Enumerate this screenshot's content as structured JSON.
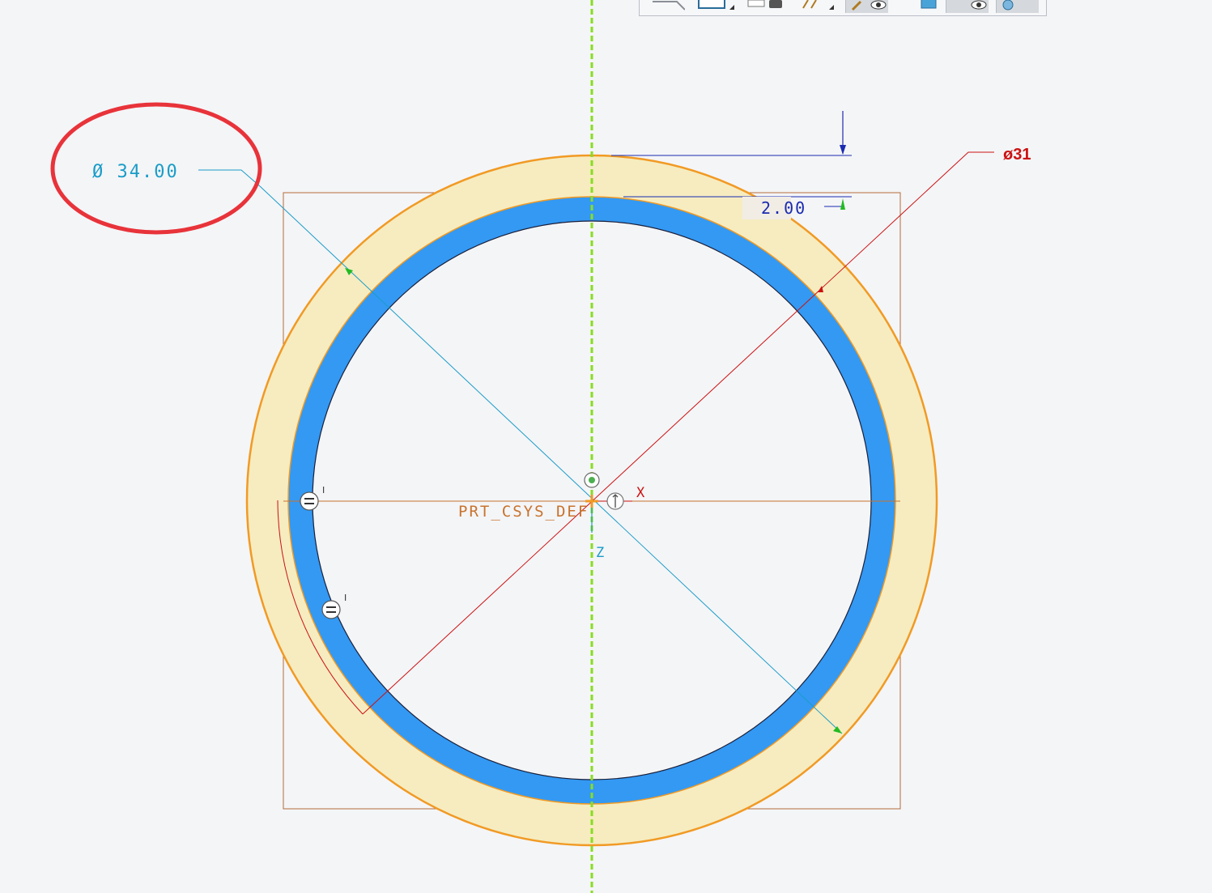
{
  "toolbar": {
    "buttons": [
      {
        "name": "zoom-tool-icon"
      },
      {
        "name": "display-style-icon"
      },
      {
        "name": "saved-views-icon"
      },
      {
        "name": "annotation-display-icon"
      },
      {
        "name": "datum-display-icon"
      },
      {
        "name": "view-manager-icon"
      },
      {
        "name": "eye-visibility-icon"
      },
      {
        "name": "appearance-icon"
      }
    ]
  },
  "sketch": {
    "outer_diameter_label": "Ø 34.00",
    "thickness_label": "2.00",
    "inner_diameter_label": "ø31",
    "csys_label": "PRT_CSYS_DEF",
    "x_axis_label": "X",
    "z_axis_label": "Z",
    "constraint_symbol": "=",
    "constraint_tick": "I"
  },
  "colors": {
    "background": "#f4f5f7",
    "outer_ring_fill": "#f6ecc0",
    "outer_ring_stroke": "#f19a24",
    "inner_ring_fill": "#3399f3",
    "centerline": "#88dd22",
    "dimension_cyan": "#1a9cc8",
    "dimension_red": "#cc1111",
    "dimension_blue": "#1a2bb0",
    "highlight_ellipse": "#e8333a",
    "frame": "#b46a38"
  }
}
